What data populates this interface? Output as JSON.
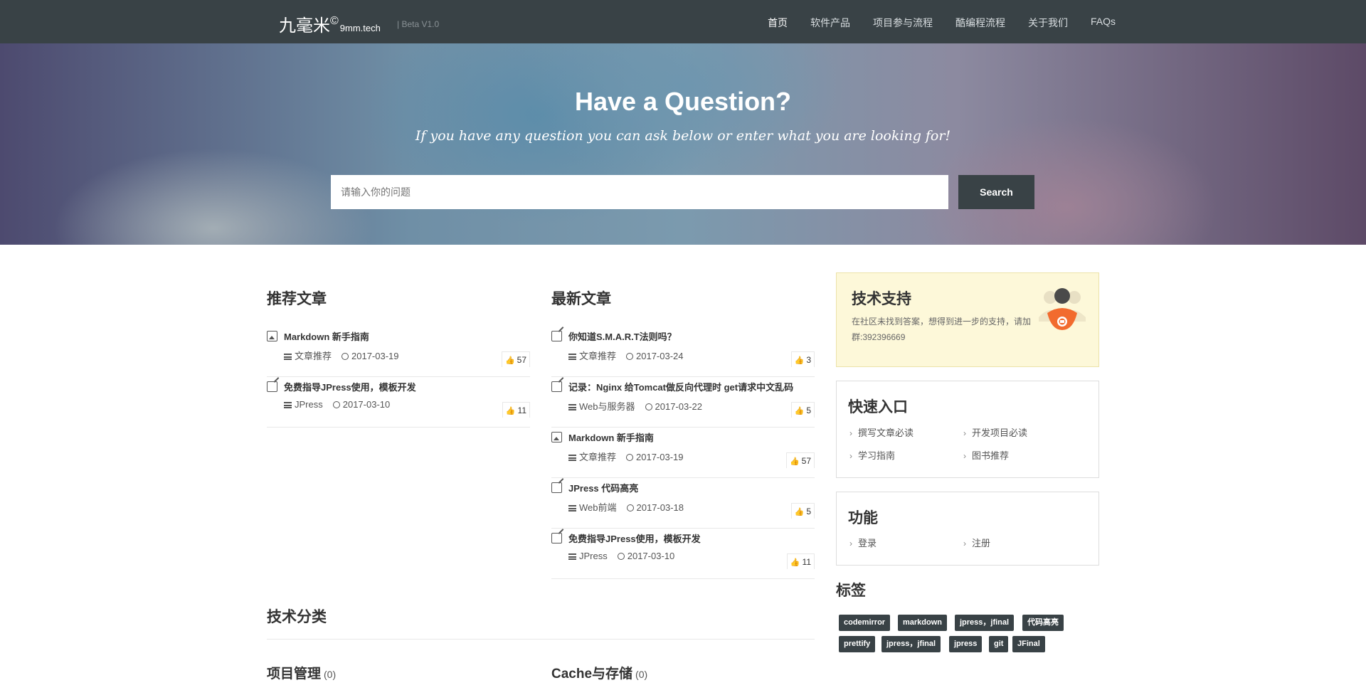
{
  "nav": {
    "brand": "九毫米",
    "brand_mark": "©",
    "brand_sub": "9mm.tech",
    "beta": "| Beta V1.0",
    "items": [
      "首页",
      "软件产品",
      "项目参与流程",
      "酷编程流程",
      "关于我们",
      "FAQs"
    ]
  },
  "hero": {
    "title": "Have a Question?",
    "subtitle": "If you have any question you can ask below or enter what you are looking for!",
    "search_placeholder": "请输入你的问题",
    "search_button": "Search"
  },
  "recommended": {
    "title": "推荐文章",
    "articles": [
      {
        "icon": "image-icon",
        "title": "Markdown 新手指南",
        "category": "文章推荐",
        "date": "2017-03-19",
        "likes": "57"
      },
      {
        "icon": "edit-icon",
        "title": "免费指导JPress使用，模板开发",
        "category": "JPress",
        "date": "2017-03-10",
        "likes": "11"
      }
    ]
  },
  "latest": {
    "title": "最新文章",
    "articles": [
      {
        "icon": "edit-icon",
        "title": "你知道S.M.A.R.T法则吗？",
        "category": "文章推荐",
        "date": "2017-03-24",
        "likes": "3"
      },
      {
        "icon": "edit-icon",
        "title": "记录：Nginx 给Tomcat做反向代理时 get请求中文乱码",
        "category": "Web与服务器",
        "date": "2017-03-22",
        "likes": "5"
      },
      {
        "icon": "image-icon",
        "title": "Markdown 新手指南",
        "category": "文章推荐",
        "date": "2017-03-19",
        "likes": "57"
      },
      {
        "icon": "edit-icon",
        "title": "JPress 代码高亮",
        "category": "Web前端",
        "date": "2017-03-18",
        "likes": "5"
      },
      {
        "icon": "edit-icon",
        "title": "免费指导JPress使用，模板开发",
        "category": "JPress",
        "date": "2017-03-10",
        "likes": "11"
      }
    ]
  },
  "support": {
    "title": "技术支持",
    "text": "在社区未找到答案，想得到进一步的支持，请加群:392396669"
  },
  "quick": {
    "title": "快速入口",
    "links": [
      "撰写文章必读",
      "开发项目必读",
      "学习指南",
      "图书推荐"
    ]
  },
  "func": {
    "title": "功能",
    "links": [
      "登录",
      "注册"
    ]
  },
  "tags": {
    "title": "标签",
    "items": [
      "codemirror",
      "markdown",
      "jpress，jfinal",
      "代码高亮",
      "prettify",
      "jpress，jfinal",
      "jpress",
      "git",
      "JFinal"
    ]
  },
  "categories": {
    "title": "技术分类",
    "items": [
      {
        "name": "项目管理",
        "count": "(0)"
      },
      {
        "name": "Cache与存储",
        "count": "(0)"
      }
    ]
  }
}
